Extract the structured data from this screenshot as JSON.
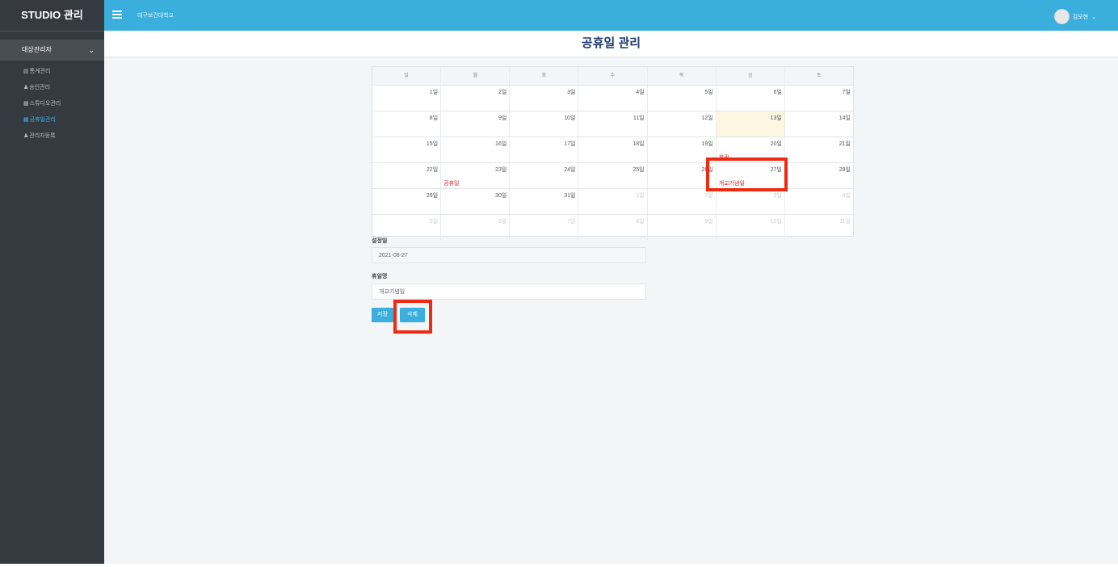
{
  "sidebar": {
    "brand": "STUDIO 관리",
    "group": "대상관리자",
    "items": [
      {
        "icon": "chart-icon",
        "glyph": "▥",
        "label": "통계관리",
        "active": false
      },
      {
        "icon": "users-icon",
        "glyph": "♟",
        "label": "승인관리",
        "active": false
      },
      {
        "icon": "calendar-icon",
        "glyph": "▦",
        "label": "스튜디오관리",
        "active": false
      },
      {
        "icon": "calendar-icon",
        "glyph": "▦",
        "label": "공휴일관리",
        "active": true
      },
      {
        "icon": "user-icon",
        "glyph": "♟",
        "label": "관리자등록",
        "active": false
      }
    ]
  },
  "topbar": {
    "school": "대구보건대학교",
    "user": "김오현"
  },
  "page": {
    "title": "공휴일 관리"
  },
  "calendar": {
    "days_of_week": [
      "일",
      "월",
      "화",
      "수",
      "목",
      "금",
      "토"
    ],
    "weeks": [
      [
        {
          "d": "1일"
        },
        {
          "d": "2일"
        },
        {
          "d": "3일"
        },
        {
          "d": "4일"
        },
        {
          "d": "5일"
        },
        {
          "d": "6일"
        },
        {
          "d": "7일"
        }
      ],
      [
        {
          "d": "8일"
        },
        {
          "d": "9일"
        },
        {
          "d": "10일"
        },
        {
          "d": "11일"
        },
        {
          "d": "12일"
        },
        {
          "d": "13일",
          "today": true
        },
        {
          "d": "14일"
        }
      ],
      [
        {
          "d": "15일"
        },
        {
          "d": "16일"
        },
        {
          "d": "17일"
        },
        {
          "d": "18일"
        },
        {
          "d": "19일"
        },
        {
          "d": "20일",
          "event": "휴관"
        },
        {
          "d": "21일"
        }
      ],
      [
        {
          "d": "22일"
        },
        {
          "d": "23일",
          "event": "공휴일"
        },
        {
          "d": "24일"
        },
        {
          "d": "25일"
        },
        {
          "d": "26일"
        },
        {
          "d": "27일",
          "event": "개교기념일"
        },
        {
          "d": "28일"
        }
      ],
      [
        {
          "d": "29일"
        },
        {
          "d": "30일"
        },
        {
          "d": "31일"
        },
        {
          "d": "1일",
          "other": true
        },
        {
          "d": "2일",
          "other": true
        },
        {
          "d": "3일",
          "other": true
        },
        {
          "d": "4일",
          "other": true
        }
      ],
      [
        {
          "d": "5일",
          "other": true
        },
        {
          "d": "6일",
          "other": true
        },
        {
          "d": "7일",
          "other": true
        },
        {
          "d": "8일",
          "other": true
        },
        {
          "d": "9일",
          "other": true
        },
        {
          "d": "10일",
          "other": true
        },
        {
          "d": "11일",
          "other": true
        }
      ]
    ]
  },
  "form": {
    "date_label": "설정일",
    "date_value": "2021-08-27",
    "name_label": "휴일명",
    "name_value": "개교기념일",
    "save_label": "저장",
    "delete_label": "삭제"
  },
  "colors": {
    "accent": "#3aaedc",
    "sidebar": "#343a40",
    "highlight": "#ee2a12",
    "event": "#e02020"
  }
}
